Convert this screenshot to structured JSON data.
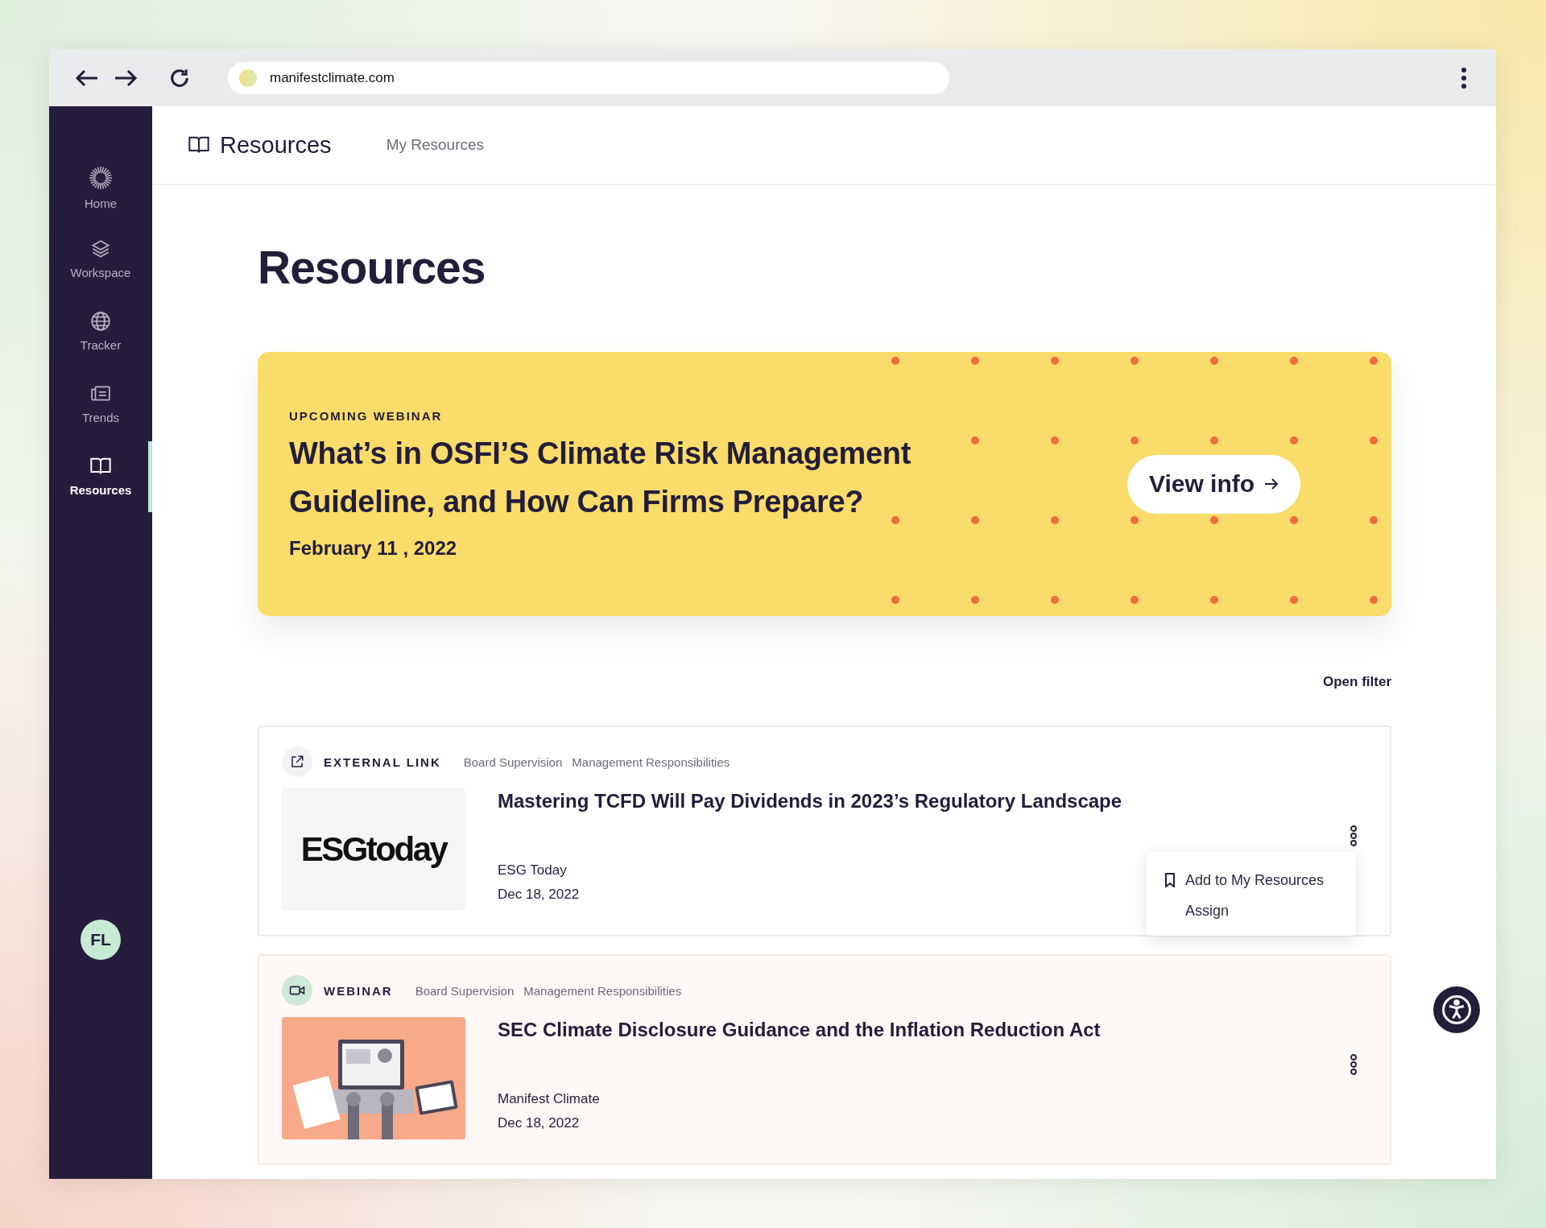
{
  "browser": {
    "url": "manifestclimate.com"
  },
  "sidebar": {
    "items": [
      {
        "label": "Home",
        "selected": false
      },
      {
        "label": "Workspace",
        "selected": false
      },
      {
        "label": "Tracker",
        "selected": false
      },
      {
        "label": "Trends",
        "selected": false
      },
      {
        "label": "Resources",
        "selected": true
      }
    ],
    "avatar": "FL"
  },
  "header": {
    "title": "Resources",
    "link": "My Resources"
  },
  "page_title": "Resources",
  "banner": {
    "eyebrow": "UPCOMING WEBINAR",
    "title": "What’s in OSFI’S Climate Risk Management Guideline, and How Can Firms Prepare?",
    "date": "February 11 , 2022",
    "button": "View info"
  },
  "filter_link": "Open filter",
  "resources": [
    {
      "kind": "external-link",
      "type_label": "EXTERNAL LINK",
      "tags": [
        "Board Supervision",
        "Management Responsibilities"
      ],
      "thumbnail": {
        "kind": "logo",
        "text": "ESGtoday"
      },
      "title": "Mastering TCFD Will Pay Dividends in 2023’s Regulatory Landscape",
      "source": "ESG Today",
      "date": "Dec 18, 2022",
      "highlighted": false,
      "menu_open": true,
      "menu": [
        {
          "label": "Add to My Resources"
        },
        {
          "label": "Assign"
        }
      ]
    },
    {
      "kind": "webinar",
      "type_label": "WEBINAR",
      "tags": [
        "Board Supervision",
        "Management Responsibilities"
      ],
      "title": "SEC Climate Disclosure Guidance and the Inflation Reduction Act",
      "source": "Manifest Climate",
      "date": "Dec 18, 2022",
      "highlighted": true,
      "menu_open": false
    }
  ]
}
